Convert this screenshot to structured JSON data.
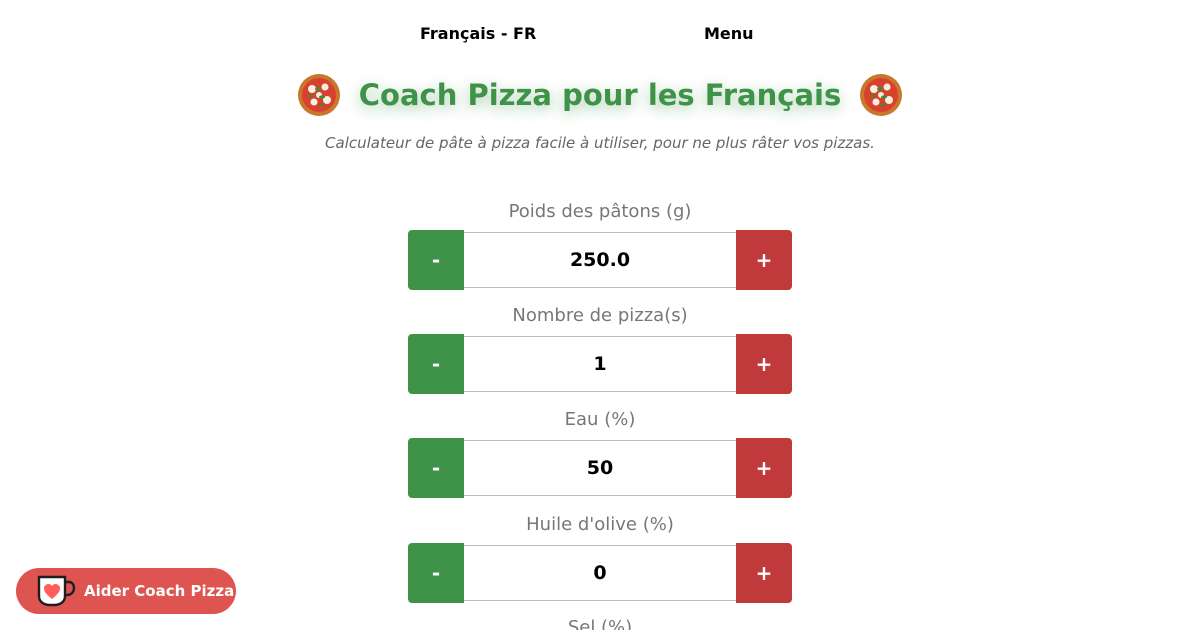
{
  "nav": {
    "language": "Français - FR",
    "menu": "Menu"
  },
  "header": {
    "title": "Coach Pizza pour les Français",
    "subtitle": "Calculateur de pâte à pizza facile à utiliser, pour ne plus râter vos pizzas.",
    "icon": "pizza-icon"
  },
  "fields": [
    {
      "label": "Poids des pâtons (g)",
      "value": "250.0",
      "minus": "-",
      "plus": "+"
    },
    {
      "label": "Nombre de pizza(s)",
      "value": "1",
      "minus": "-",
      "plus": "+"
    },
    {
      "label": "Eau (%)",
      "value": "50",
      "minus": "-",
      "plus": "+"
    },
    {
      "label": "Huile d'olive (%)",
      "value": "0",
      "minus": "-",
      "plus": "+"
    },
    {
      "label": "Sel (%)"
    }
  ],
  "support": {
    "label": "Aider Coach Pizza",
    "icon": "coffee-cup-heart-icon"
  },
  "colors": {
    "green": "#3e9348",
    "red": "#c0393b",
    "support": "#dd5450"
  }
}
